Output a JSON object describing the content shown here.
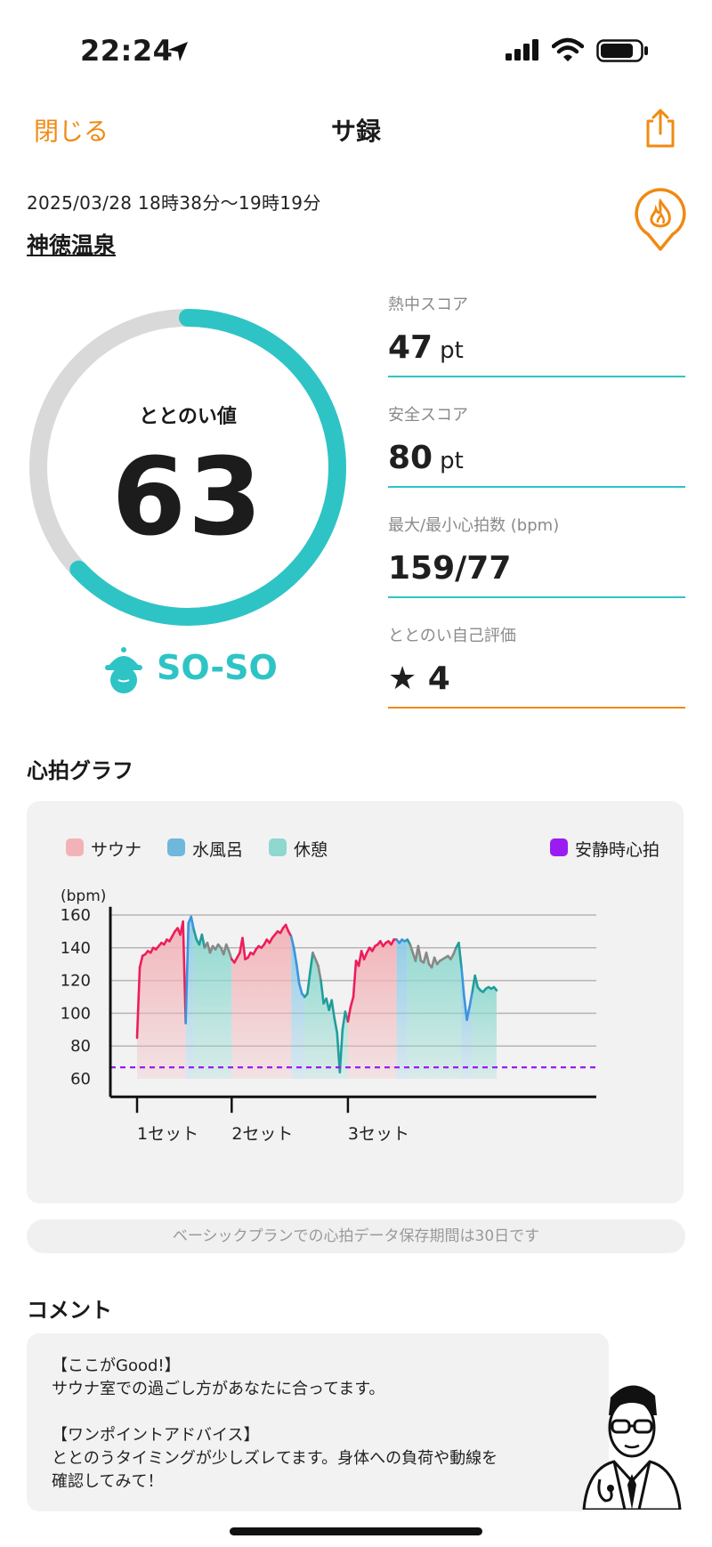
{
  "status_bar": {
    "time": "22:24"
  },
  "nav": {
    "close_label": "閉じる",
    "title": "サ録"
  },
  "session": {
    "datetime": "2025/03/28 18時38分〜19時19分",
    "facility": "神徳温泉"
  },
  "totonoi": {
    "label": "ととのい値",
    "value": "63",
    "progress": 0.63,
    "mood": "SO-SO"
  },
  "stats": [
    {
      "label": "熱中スコア",
      "value": "47",
      "unit": "pt"
    },
    {
      "label": "安全スコア",
      "value": "80",
      "unit": "pt"
    },
    {
      "label": "最大/最小心拍数 (bpm)",
      "value": "159/77",
      "unit": ""
    },
    {
      "label": "ととのい自己評価",
      "value": "★ 4",
      "unit": ""
    }
  ],
  "heart": {
    "section_title": "心拍グラフ",
    "notice": "ベーシックプランでの心拍データ保存期間は30日です"
  },
  "colors": {
    "accent": "#f08a12",
    "teal": "#2ec4c6",
    "sauna": "#ee1d5a",
    "sauna_fill": "#f2b3b8",
    "cold": "#3a95dc",
    "cold_fill": "#8fcbe6",
    "rest": "#1f9e9c",
    "rest_fill": "#8ed8cf",
    "gray_line": "#888888",
    "resting": "#9b1cf2"
  },
  "chart_data": {
    "type": "line",
    "ylabel": "(bpm)",
    "ylim": [
      55,
      165
    ],
    "yticks": [
      "160",
      "140",
      "120",
      "100",
      "80",
      "60"
    ],
    "xticks": [
      "1セット",
      "2セット",
      "3セット"
    ],
    "legend": [
      "サウナ",
      "水風呂",
      "休憩",
      "安静時心拍"
    ],
    "resting_hr": 67,
    "x": [
      0,
      1,
      2,
      3,
      4,
      5,
      6,
      7,
      8,
      9,
      10,
      11,
      12,
      13,
      14,
      15,
      16,
      17,
      18,
      19,
      20,
      21,
      22,
      23,
      24,
      25,
      26,
      27,
      28,
      29,
      30,
      31,
      32,
      33,
      34,
      35,
      36,
      37,
      38,
      39,
      40,
      41,
      42,
      43,
      44,
      45,
      46,
      47,
      48,
      49,
      50,
      51,
      52,
      53,
      54,
      55,
      56,
      57,
      58,
      59,
      60,
      61,
      62,
      63,
      64,
      65,
      66,
      67,
      68,
      69,
      70,
      71,
      72,
      73,
      74,
      75,
      76,
      77,
      78,
      79,
      80,
      81,
      82,
      83,
      84,
      85,
      86,
      87,
      88,
      89,
      90,
      91,
      92,
      93,
      94,
      95,
      96,
      97,
      98,
      99,
      100,
      101,
      102,
      103,
      104,
      105,
      106,
      107,
      108,
      109,
      110,
      111,
      112,
      113,
      114,
      115,
      116,
      117,
      118,
      119,
      120,
      121,
      122,
      123,
      124,
      125,
      126,
      127,
      128,
      129,
      130,
      131,
      132,
      133
    ],
    "series": [
      {
        "name": "心拍",
        "values": [
          85,
          128,
          135,
          136,
          138,
          137,
          140,
          139,
          141,
          143,
          142,
          145,
          144,
          147,
          150,
          152,
          148,
          156,
          94,
          155,
          159,
          151,
          145,
          142,
          148,
          140,
          143,
          137,
          141,
          139,
          142,
          140,
          136,
          142,
          138,
          133,
          131,
          134,
          137,
          146,
          133,
          134,
          137,
          136,
          139,
          141,
          140,
          142,
          145,
          143,
          146,
          148,
          150,
          149,
          152,
          154,
          150,
          147,
          140,
          130,
          118,
          112,
          110,
          112,
          125,
          137,
          133,
          129,
          120,
          106,
          109,
          102,
          108,
          97,
          88,
          64,
          90,
          101,
          95,
          104,
          110,
          132,
          129,
          138,
          133,
          137,
          140,
          138,
          141,
          142,
          144,
          141,
          143,
          144,
          142,
          145,
          145,
          143,
          145,
          144,
          145,
          142,
          137,
          132,
          141,
          132,
          131,
          137,
          130,
          128,
          134,
          130,
          132,
          133,
          134,
          135,
          133,
          136,
          140,
          143,
          128,
          110,
          96,
          104,
          113,
          123,
          116,
          114,
          113,
          115,
          116,
          115,
          116,
          114
        ]
      }
    ],
    "phases": [
      {
        "type": "sauna",
        "start": 0,
        "end": 18
      },
      {
        "type": "cold",
        "start": 18,
        "end": 21
      },
      {
        "type": "rest",
        "start": 21,
        "end": 35
      },
      {
        "type": "sauna",
        "start": 35,
        "end": 57
      },
      {
        "type": "cold",
        "start": 57,
        "end": 62
      },
      {
        "type": "rest",
        "start": 62,
        "end": 78
      },
      {
        "type": "sauna",
        "start": 78,
        "end": 96
      },
      {
        "type": "cold",
        "start": 96,
        "end": 100
      },
      {
        "type": "rest",
        "start": 100,
        "end": 120
      },
      {
        "type": "cold",
        "start": 120,
        "end": 124
      },
      {
        "type": "rest",
        "start": 124,
        "end": 133
      }
    ],
    "set_markers": [
      0,
      35,
      78
    ]
  },
  "comment": {
    "section_title": "コメント",
    "text": "【ここがGood!】\nサウナ室での過ごし方があなたに合ってます。\n\n【ワンポイントアドバイス】\nととのうタイミングが少しズレてます。身体への負荷や動線を\n確認してみて！"
  }
}
